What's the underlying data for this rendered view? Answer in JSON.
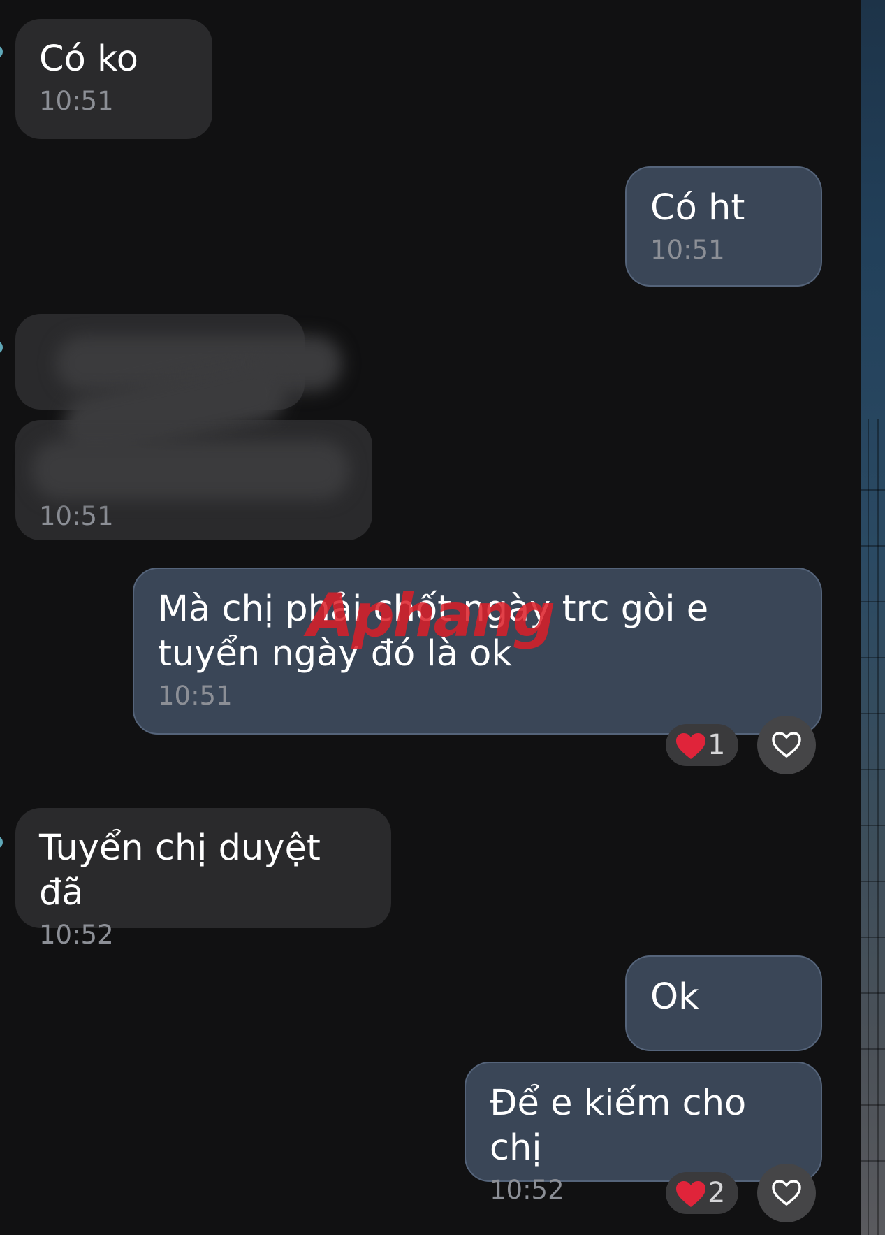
{
  "messages": [
    {
      "text": "Có ko",
      "time": "10:51"
    },
    {
      "text": "Có ht",
      "time": "10:51"
    },
    {
      "text": "",
      "time": "10:51"
    },
    {
      "text": "Mà chị phải chốt ngày trc gòi e tuyển ngày đó là ok",
      "time": "10:51"
    },
    {
      "text": "Tuyển chị duyệt đã",
      "time": "10:52"
    },
    {
      "text": "Ok",
      "time": ""
    },
    {
      "text": "Để e kiếm cho chị",
      "time": "10:52"
    }
  ],
  "reactions": [
    {
      "count": "1"
    },
    {
      "count": "2"
    }
  ],
  "watermark": "Aphang",
  "colors": {
    "background": "#111112",
    "incoming_bubble": "#2a2a2c",
    "outgoing_bubble": "#3a4657",
    "timestamp": "#8c8f96",
    "heart": "#e0243a"
  }
}
